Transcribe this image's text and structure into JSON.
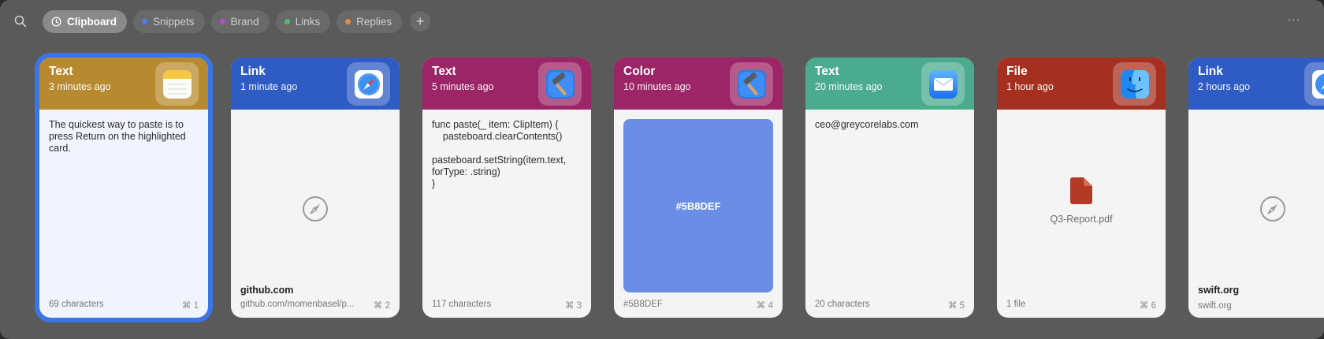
{
  "tabs": [
    {
      "label": "Clipboard",
      "active": true,
      "icon": "clock-icon"
    },
    {
      "label": "Snippets",
      "color": "#4a80e8"
    },
    {
      "label": "Brand",
      "color": "#b04fcf"
    },
    {
      "label": "Links",
      "color": "#4fbf63"
    },
    {
      "label": "Replies",
      "color": "#ec8a3a"
    }
  ],
  "add_tab_label": "+",
  "more_label": "···",
  "cards": [
    {
      "type": "Text",
      "time": "3 minutes ago",
      "header_color": "#b88a2f",
      "app": "notes-app-icon",
      "text": "The quickest way to paste is to press Return on the highlighted card.",
      "footer_left": "69 characters",
      "shortcut": "⌘ 1"
    },
    {
      "type": "Link",
      "time": "1 minute ago",
      "header_color": "#2e5bc4",
      "app": "safari-app-icon",
      "link_title": "github.com",
      "footer_left": "github.com/momenbasel/p...",
      "shortcut": "⌘ 2"
    },
    {
      "type": "Text",
      "time": "5 minutes ago",
      "header_color": "#9b2566",
      "app": "xcode-app-icon",
      "text": "func paste(_ item: ClipItem) {\n    pasteboard.clearContents()\n\npasteboard.setString(item.text,\nforType: .string)\n}",
      "footer_left": "117 characters",
      "shortcut": "⌘ 3"
    },
    {
      "type": "Color",
      "time": "10 minutes ago",
      "header_color": "#9b2566",
      "app": "xcode-app-icon",
      "swatch": "#5B8DEF",
      "swatch_label": "#5B8DEF",
      "footer_left": "#5B8DEF",
      "shortcut": "⌘ 4"
    },
    {
      "type": "Text",
      "time": "20 minutes ago",
      "header_color": "#4aab8d",
      "app": "mail-app-icon",
      "text": "ceo@greycorelabs.com",
      "footer_left": "20 characters",
      "shortcut": "⌘ 5"
    },
    {
      "type": "File",
      "time": "1 hour ago",
      "header_color": "#a5301f",
      "app": "finder-app-icon",
      "file_name": "Q3-Report.pdf",
      "footer_left": "1 file",
      "shortcut": "⌘ 6"
    },
    {
      "type": "Link",
      "time": "2 hours ago",
      "header_color": "#2e5bc4",
      "app": "safari-app-icon",
      "link_title": "swift.org",
      "footer_left": "swift.org",
      "shortcut": ""
    }
  ]
}
